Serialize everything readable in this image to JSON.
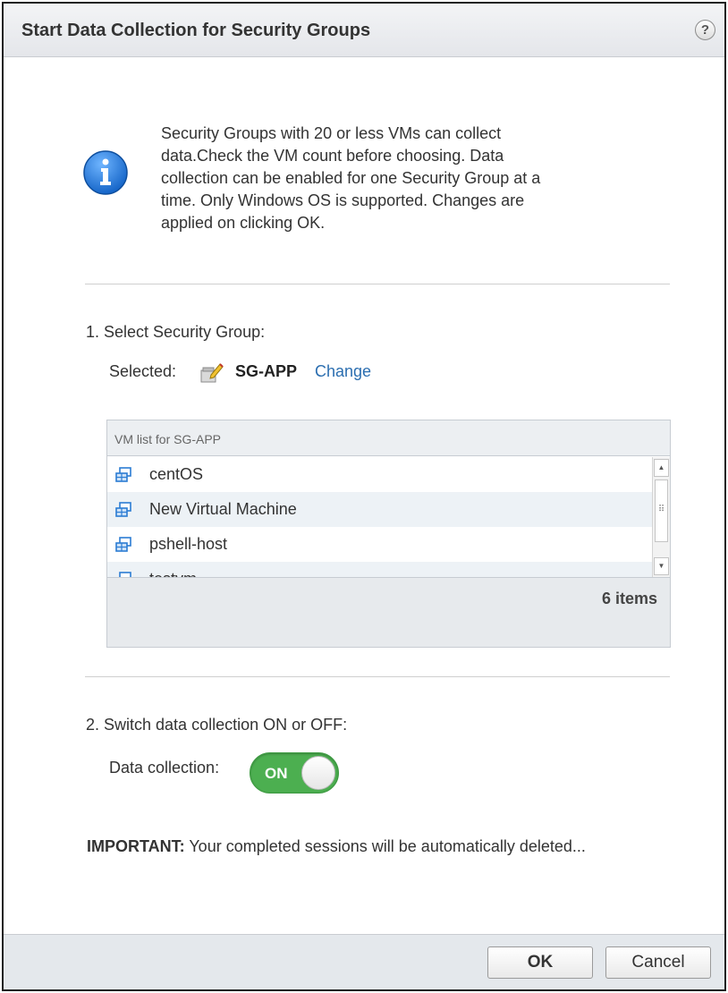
{
  "dialog": {
    "title": "Start Data Collection for Security Groups",
    "help_label": "?"
  },
  "info": {
    "icon": "info-icon",
    "line1": "Security Groups with 20 or less VMs can collect",
    "line2": "data.Check the VM count before choosing. Data",
    "line3": "collection can be enabled for one Security Group at a",
    "line4": "time. Only Windows OS is supported. Changes are",
    "line5": "applied on clicking OK."
  },
  "step1": {
    "label": "1. Select Security Group:",
    "selected_label": "Selected:",
    "selected_icon": "security-group-edit-icon",
    "selected_value": "SG-APP",
    "change_label": "Change"
  },
  "vm_list": {
    "header": "VM list for SG-APP",
    "items": [
      {
        "name": "centOS",
        "icon": "vm-icon"
      },
      {
        "name": "New Virtual Machine",
        "icon": "vm-icon"
      },
      {
        "name": "pshell-host",
        "icon": "vm-icon"
      },
      {
        "name": "testvm",
        "icon": "vm-icon"
      }
    ],
    "count_label": "6 items"
  },
  "step2": {
    "label": "2. Switch data collection ON or OFF:",
    "toggle_label": "Data collection:",
    "toggle_state": "ON",
    "toggle_color": "#4caf50"
  },
  "important": {
    "prefix": "IMPORTANT:",
    "text": " Your completed sessions will be automatically deleted..."
  },
  "buttons": {
    "ok": "OK",
    "cancel": "Cancel"
  }
}
